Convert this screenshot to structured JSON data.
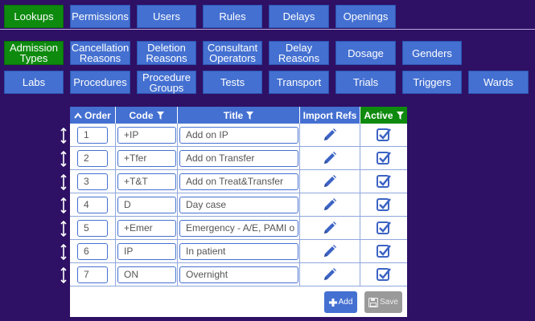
{
  "top_tabs": [
    {
      "label": "Lookups",
      "active": true
    },
    {
      "label": "Permissions"
    },
    {
      "label": "Users"
    },
    {
      "label": "Rules"
    },
    {
      "label": "Delays"
    },
    {
      "label": "Openings"
    }
  ],
  "sub_tabs_row1": [
    {
      "label": "Admission Types",
      "active": true
    },
    {
      "label": "Cancellation Reasons"
    },
    {
      "label": "Deletion Reasons"
    },
    {
      "label": "Consultant Operators"
    },
    {
      "label": "Delay Reasons"
    },
    {
      "label": "Dosage"
    },
    {
      "label": "Genders"
    }
  ],
  "sub_tabs_row2": [
    {
      "label": "Labs"
    },
    {
      "label": "Procedures"
    },
    {
      "label": "Procedure Groups"
    },
    {
      "label": "Tests"
    },
    {
      "label": "Transport"
    },
    {
      "label": "Trials"
    },
    {
      "label": "Triggers"
    },
    {
      "label": "Wards"
    }
  ],
  "table": {
    "headers": {
      "order": "Order",
      "code": "Code",
      "title": "Title",
      "import_refs": "Import Refs",
      "active": "Active"
    },
    "rows": [
      {
        "order": "1",
        "code": "+IP",
        "title": "Add on IP",
        "active": true
      },
      {
        "order": "2",
        "code": "+Tfer",
        "title": "Add on Transfer",
        "active": true
      },
      {
        "order": "3",
        "code": "+T&T",
        "title": "Add on Treat&Transfer",
        "active": true
      },
      {
        "order": "4",
        "code": "D",
        "title": "Day case",
        "active": true
      },
      {
        "order": "5",
        "code": "+Emer",
        "title": "Emergency - A/E, PAMI o",
        "active": true
      },
      {
        "order": "6",
        "code": "IP",
        "title": "In patient",
        "active": true
      },
      {
        "order": "7",
        "code": "ON",
        "title": "Overnight",
        "active": true
      }
    ]
  },
  "buttons": {
    "add": "Add",
    "save": "Save"
  },
  "colors": {
    "background": "#2e1065",
    "tab_blue": "#4470d1",
    "tab_active_green": "#0e8a0e",
    "disabled_gray": "#9a9a9a"
  },
  "icons": {
    "sort": "caret-up-icon",
    "filter": "filter-icon",
    "edit": "pencil-icon",
    "checkbox": "checkbox-checked-icon",
    "drag": "drag-handle-icon",
    "add": "plus-icon",
    "save": "floppy-disk-icon"
  }
}
